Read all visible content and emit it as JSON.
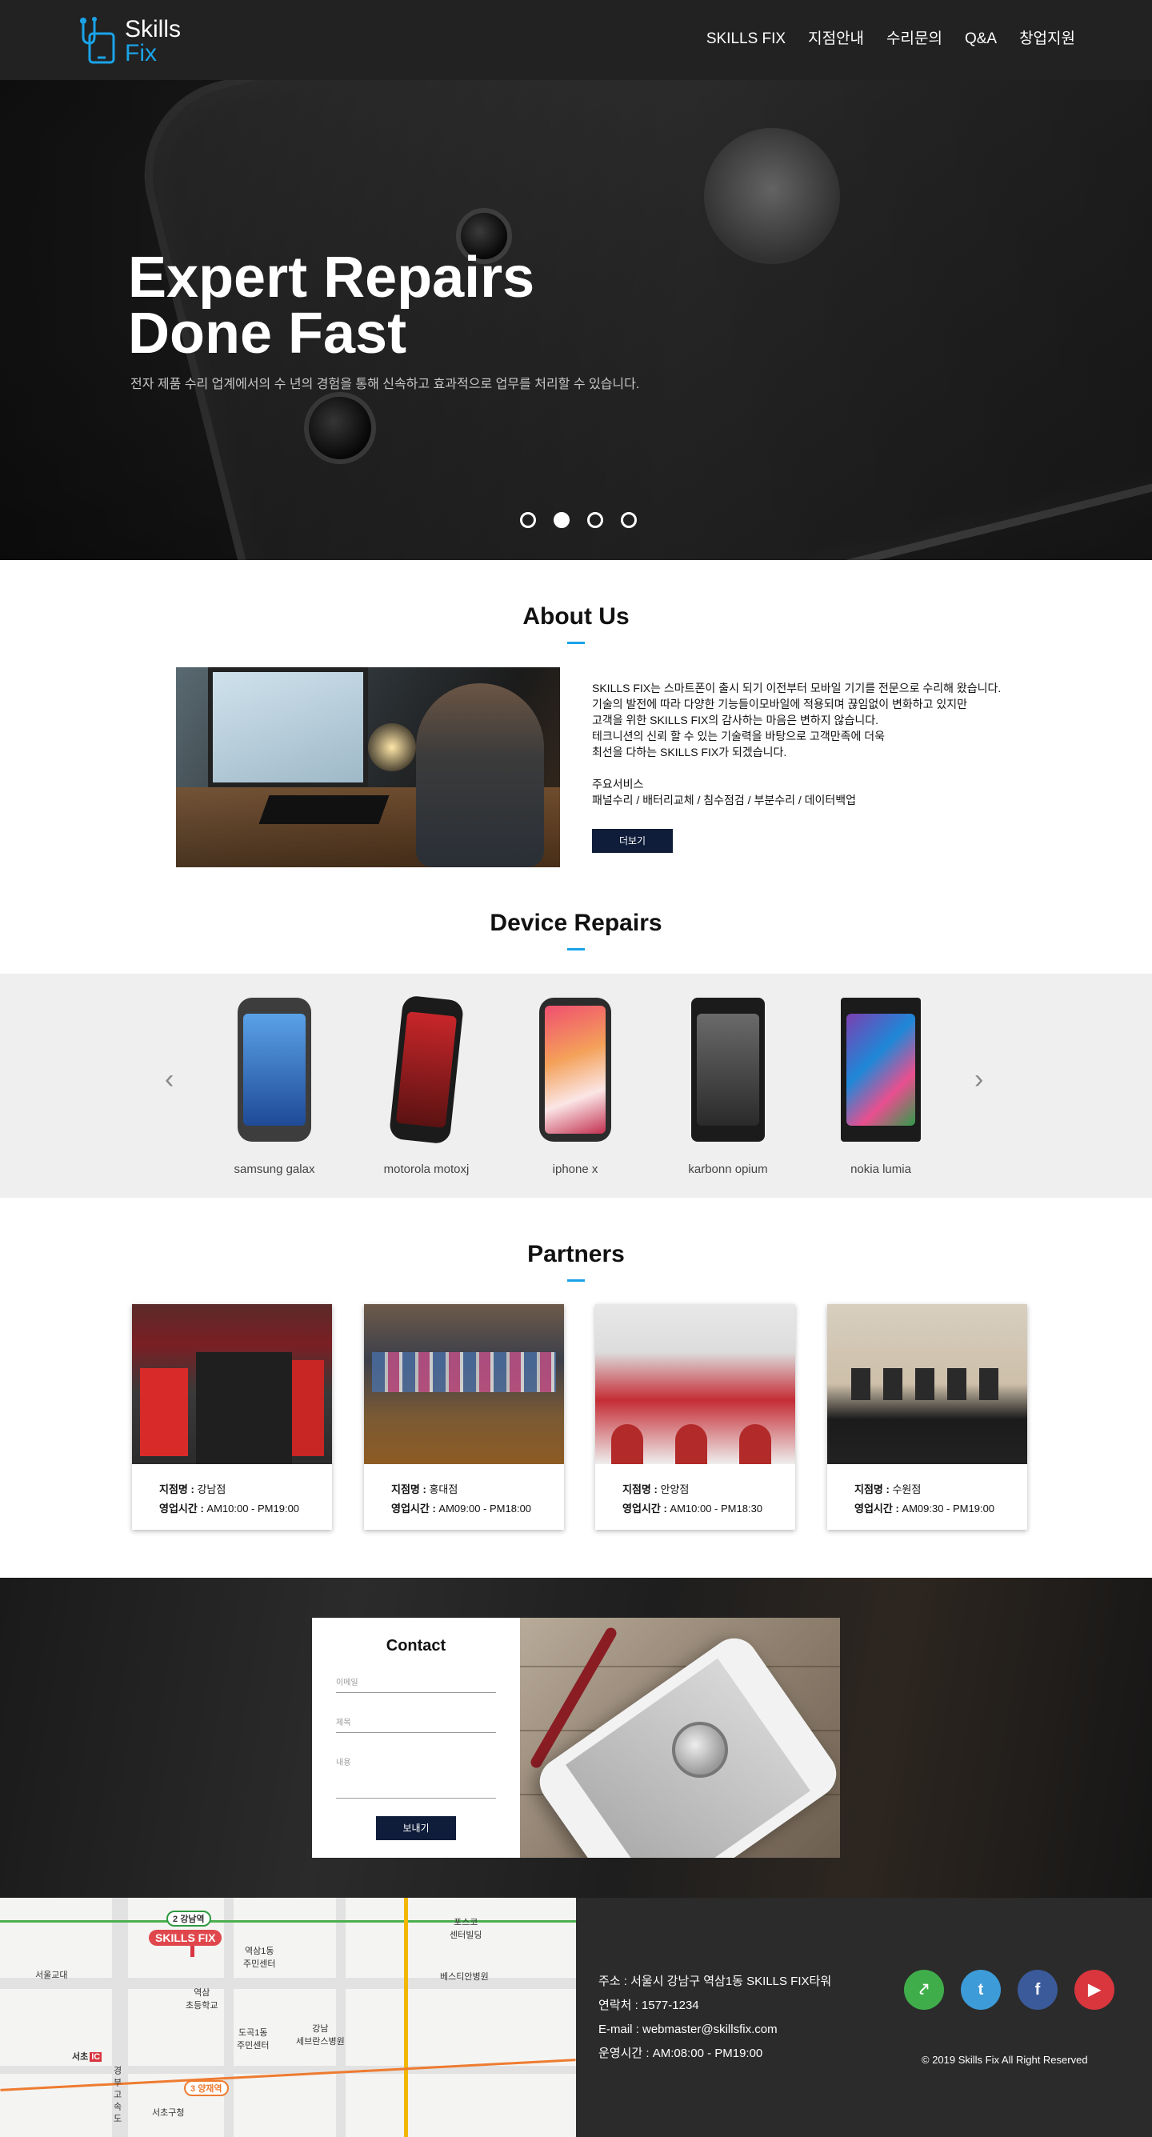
{
  "header": {
    "logo_line1": "Skills",
    "logo_line2": "Fix",
    "nav": [
      "SKILLS FIX",
      "지점안내",
      "수리문의",
      "Q&A",
      "창업지원"
    ]
  },
  "hero": {
    "title": "Expert Repairs\nDone Fast",
    "subtitle": "전자 제품 수리 업계에서의 수 년의 경험을 통해 신속하고 효과적으로 업무를 처리할 수 있습니다.",
    "slides_total": 4,
    "active_slide": 2
  },
  "about": {
    "title": "About Us",
    "paragraph": "SKILLS FIX는 스마트폰이 출시 되기 이전부터 모바일 기기를 전문으로 수리해 왔습니다.\n기술의 발전에 따라 다양한 기능들이모바일에 적용되며 끊임없이 변화하고 있지만\n고객을 위한 SKILLS FIX의 감사하는 마음은 변하지 않습니다.\n테크니션의 신뢰 할 수 있는 기술력을 바탕으로 고객만족에 더욱\n최선을 다하는 SKILLS FIX가 되겠습니다.",
    "services_title": "주요서비스",
    "services": "패널수리 / 배터리교체 / 침수점검 / 부분수리 / 데이터백업",
    "more_label": "더보기"
  },
  "devices": {
    "title": "Device Repairs",
    "prev_icon": "chevron-left-icon",
    "next_icon": "chevron-right-icon",
    "items": [
      {
        "name": "samsung galax"
      },
      {
        "name": "motorola motoxj"
      },
      {
        "name": "iphone x"
      },
      {
        "name": "karbonn opium"
      },
      {
        "name": "nokia lumia"
      }
    ]
  },
  "partners": {
    "title": "Partners",
    "name_label": "지점명 :",
    "hours_label": "영업시간 :",
    "items": [
      {
        "branch": "강남점",
        "hours": "AM10:00 - PM19:00"
      },
      {
        "branch": "홍대점",
        "hours": "AM09:00 - PM18:00"
      },
      {
        "branch": "안양점",
        "hours": "AM10:00 - PM18:30"
      },
      {
        "branch": "수원점",
        "hours": "AM09:30 - PM19:00"
      }
    ]
  },
  "contact": {
    "title": "Contact",
    "email_placeholder": "이메일",
    "subject_placeholder": "제목",
    "message_placeholder": "내용",
    "send_label": "보내기"
  },
  "map": {
    "labels": {
      "station_gangnam": "강남역",
      "brand": "SKILLS FIX",
      "yeoksam_center": "역삼1동\n주민센터",
      "posco": "포스코\n센터빌딩",
      "seoul_edu": "서울교대",
      "yeoksam_school": "역삼\n초등학교",
      "bestian": "베스티안병원",
      "dogok": "도곡1동\n주민센터",
      "gangnam_hospital": "강남\n세브란스병원",
      "seocho_ic": "서초",
      "ic": "IC",
      "highway": "경부고속도",
      "yangjae": "양재역",
      "seocho_office": "서초구청",
      "line2": "2",
      "line3": "3"
    }
  },
  "footer": {
    "address": "주소 : 서울시 강남구 역삼1동 SKILLS FIX타워",
    "phone": "연락처 : 1577-1234",
    "email": "E-mail : webmaster@skillsfix.com",
    "hours": "운영시간 : AM:08:00 - PM19:00",
    "copyright": "© 2019 Skills Fix All Right Reserved",
    "social": [
      {
        "name": "share-icon",
        "color": "#3fae4a"
      },
      {
        "name": "twitter-icon",
        "color": "#3d9bd8"
      },
      {
        "name": "facebook-icon",
        "color": "#3b5a9a"
      },
      {
        "name": "youtube-icon",
        "color": "#d9363e"
      }
    ]
  },
  "colors": {
    "accent": "#1aa3e8",
    "button": "#0f1d3a",
    "header": "#222222"
  }
}
